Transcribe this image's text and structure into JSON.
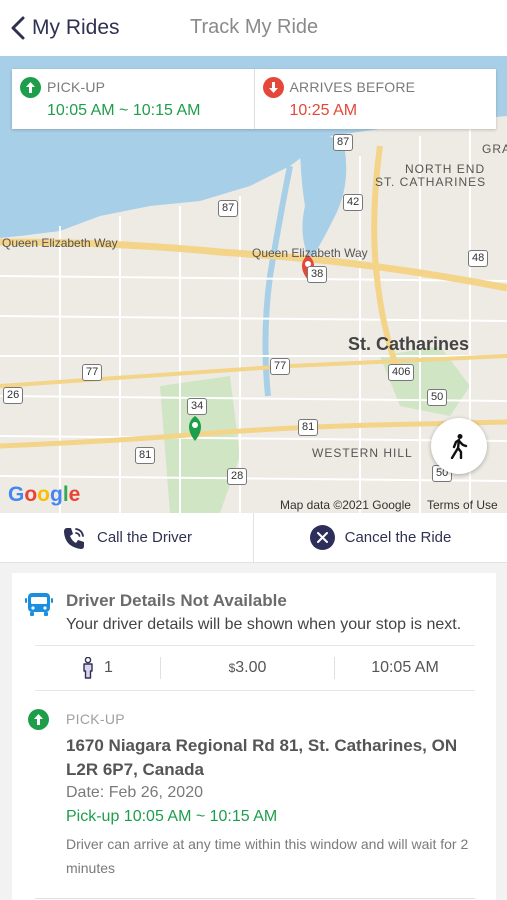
{
  "header": {
    "back_label": "My Rides",
    "title": "Track My Ride"
  },
  "time_card": {
    "pickup_label": "PICK-UP",
    "pickup_window": "10:05 AM ~ 10:15 AM",
    "arrives_label": "ARRIVES BEFORE",
    "arrives_time": "10:25 AM"
  },
  "map": {
    "labels": {
      "queen_e_west": "Queen Elizabeth Way",
      "queen_e_east": "Queen Elizabeth Way",
      "north_end": "NORTH END",
      "north_end_2": "ST. CATHARINES",
      "st_catharines": "St. Catharines",
      "western_hill": "WESTERN HILL",
      "gra": "GRA"
    },
    "shields": [
      "87",
      "42",
      "87",
      "38",
      "48",
      "77",
      "77",
      "406",
      "26",
      "34",
      "81",
      "81",
      "50",
      "50",
      "28"
    ],
    "google_logo": "Google",
    "attribution": "Map data ©2021 Google",
    "terms": "Terms of Use",
    "colors": {
      "water": "#a8cfe8",
      "land": "#eeebe4",
      "highway": "#f3d489",
      "pickup_pin": "#1e9e4a",
      "dropoff_pin": "#e5473a"
    }
  },
  "actions": {
    "call_label": "Call the Driver",
    "cancel_label": "Cancel the Ride"
  },
  "details": {
    "driver_title": "Driver Details Not Available",
    "driver_subtitle": "Your driver details will be shown when your stop is next.",
    "passengers": "1",
    "fare_symbol": "$",
    "fare": "3.00",
    "time": "10:05 AM",
    "pickup_label": "PICK-UP",
    "address": "1670 Niagara Regional Rd 81, St. Catharines, ON L2R 6P7, Canada",
    "date": "Date: Feb 26, 2020",
    "pickup_window": "Pick-up 10:05 AM ~ 10:15 AM",
    "note": "Driver can arrive at any time within this window and will wait for 2 minutes"
  },
  "colors": {
    "accent_navy": "#2f3152",
    "green": "#1e9e4a",
    "red": "#e5473a",
    "bus_blue": "#1a8fe0"
  }
}
